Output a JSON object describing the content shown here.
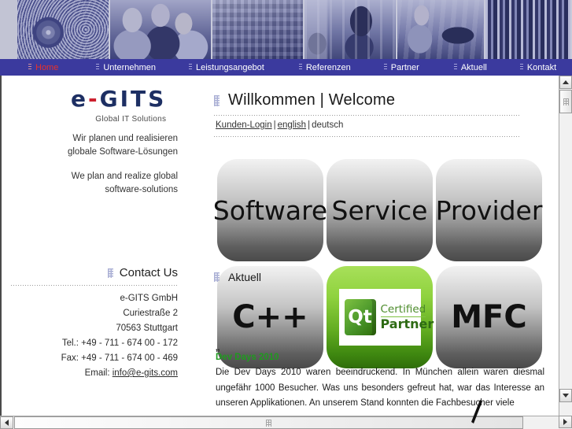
{
  "banner": {
    "panels": [
      {
        "name": "globe-network-photo"
      },
      {
        "name": "business-people-photo"
      },
      {
        "name": "server-rack-photo"
      },
      {
        "name": "office-laptop-photo"
      },
      {
        "name": "lab-technician-photo"
      },
      {
        "name": "circuit-board-photo"
      }
    ]
  },
  "nav": {
    "items": [
      {
        "label": "Home",
        "active": true
      },
      {
        "label": "Unternehmen",
        "active": false
      },
      {
        "label": "Leistungsangebot",
        "active": false
      },
      {
        "label": "Referenzen",
        "active": false
      },
      {
        "label": "Partner",
        "active": false
      },
      {
        "label": "Aktuell",
        "active": false
      },
      {
        "label": "Kontakt",
        "active": false
      }
    ],
    "active_color": "#e8312a",
    "bar_color": "#3b3a9e",
    "text_color": "#ffffff"
  },
  "logo": {
    "part1": "e",
    "dash": "-",
    "part2": "GITS",
    "subtitle": "Global IT Solutions",
    "color": "#1d2f63",
    "dash_color": "#cc1f2d"
  },
  "tagline": {
    "de_line1": "Wir planen und realisieren",
    "de_line2": "globale Software-Lösungen",
    "en_line1": "We plan and realize global",
    "en_line2": "software-solutions"
  },
  "contact": {
    "title": "Contact Us",
    "company": "e-GITS GmbH",
    "street": "Curiestraße 2",
    "city": "70563 Stuttgart",
    "tel": "Tel.: +49 - 711 - 674 00 - 172",
    "fax": "Fax: +49 - 711 - 674 00 - 469",
    "email_label": "Email:",
    "email": "info@e-gits.com"
  },
  "main": {
    "heading": "Willkommen | Welcome",
    "lang": {
      "login": "Kunden-Login",
      "sep1": "|",
      "english": "english",
      "sep2": "|",
      "deutsch": "deutsch"
    },
    "tiles_row1": [
      {
        "label": "Software",
        "type": "text"
      },
      {
        "label": "Service",
        "type": "text"
      },
      {
        "label": "Provider",
        "type": "text"
      }
    ],
    "tiles_row2": [
      {
        "label": "C++",
        "type": "text"
      },
      {
        "label": "Qt Certified Partner",
        "type": "badge",
        "badge": {
          "mark": "Qt",
          "line1": "Certified",
          "line2": "Partner"
        }
      },
      {
        "label": "MFC",
        "type": "text"
      }
    ],
    "section_title": "Aktuell",
    "article": {
      "quote": "„",
      "headline": "Dev Days 2010",
      "body": "Die Dev Days 2010 waren beeindruckend. In München allein waren diesmal ungefähr 1000 Besucher. Was uns besonders gefreut hat, war das Interesse an unseren Applikationen. An unserem Stand konnten die Fachbesucher viele",
      "headline_color": "#1f9a1f"
    }
  },
  "scrollbars": {
    "vertical": {
      "up": "▲",
      "down": "▼"
    },
    "horizontal": {
      "left": "◀",
      "right": "▶"
    }
  }
}
